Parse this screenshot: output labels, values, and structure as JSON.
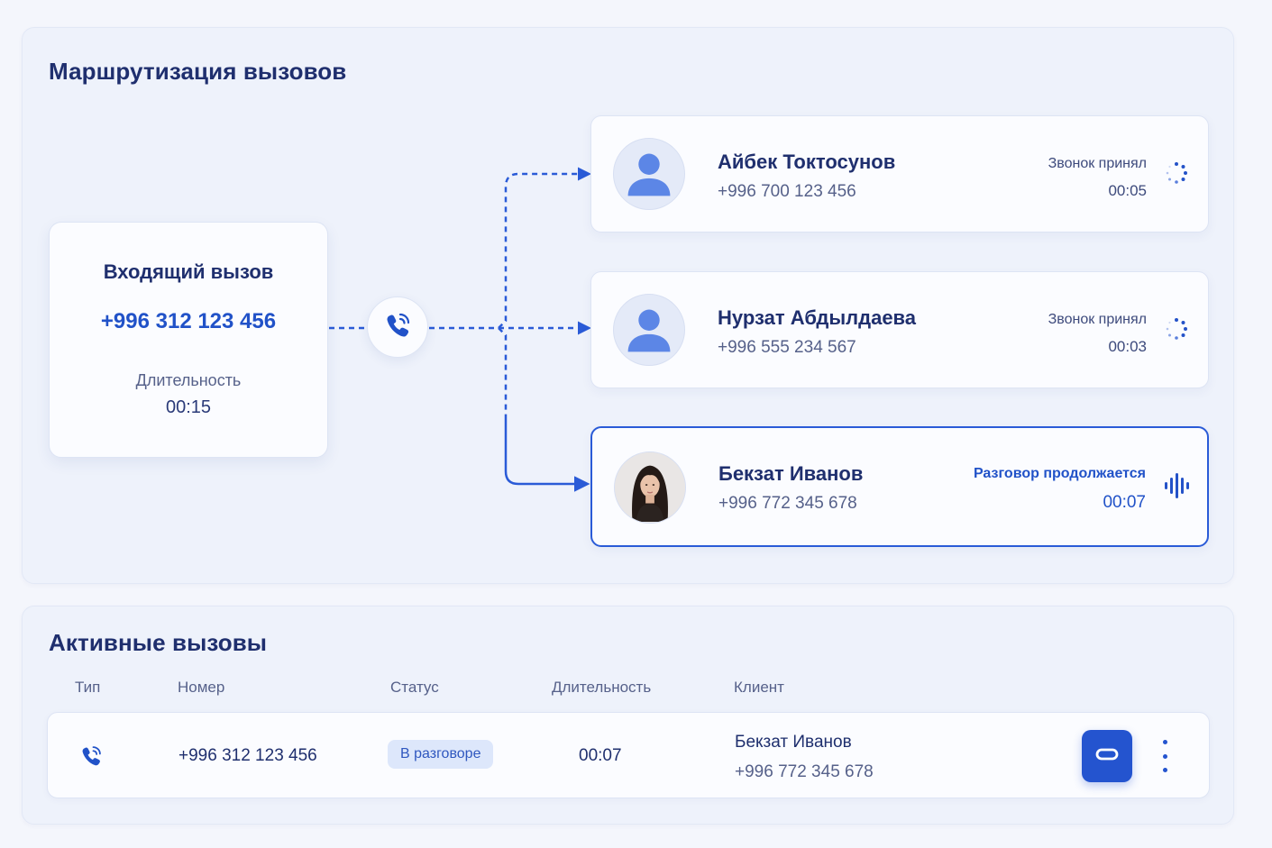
{
  "colors": {
    "accent": "#2454cf",
    "text": "#1f2f6e",
    "muted": "#56618a",
    "badge_bg": "#dde7fb"
  },
  "routing": {
    "title": "Маршрутизация вызовов",
    "incoming": {
      "title": "Входящий вызов",
      "phone": "+996 312 123 456",
      "duration_label": "Длительность",
      "duration": "00:15",
      "icon": "phone-ringing-icon"
    },
    "agents": [
      {
        "name": "Айбек Токтосунов",
        "phone": "+996 700 123 456",
        "status": "Звонок принял",
        "time": "00:05",
        "state_icon": "loading-spinner-icon",
        "avatar": "user-placeholder-icon"
      },
      {
        "name": "Нурзат Абдылдаева",
        "phone": "+996 555 234 567",
        "status": "Звонок принял",
        "time": "00:03",
        "state_icon": "loading-spinner-icon",
        "avatar": "user-placeholder-icon"
      },
      {
        "name": "Бекзат Иванов",
        "phone": "+996 772 345 678",
        "status": "Разговор продолжается",
        "time": "00:07",
        "state_icon": "audio-wave-icon",
        "avatar": "user-photo"
      }
    ]
  },
  "active_calls": {
    "title": "Активные вызовы",
    "columns": [
      "Тип",
      "Номер",
      "Статус",
      "Длительность",
      "Клиент"
    ],
    "rows": [
      {
        "type_icon": "phone-ringing-icon",
        "number": "+996 312 123 456",
        "status": "В разговоре",
        "duration": "00:07",
        "client_name": "Бекзат Иванов",
        "client_phone": "+996 772 345 678",
        "action_icon": "hangup-icon",
        "menu_icon": "more-vertical-icon"
      }
    ]
  }
}
